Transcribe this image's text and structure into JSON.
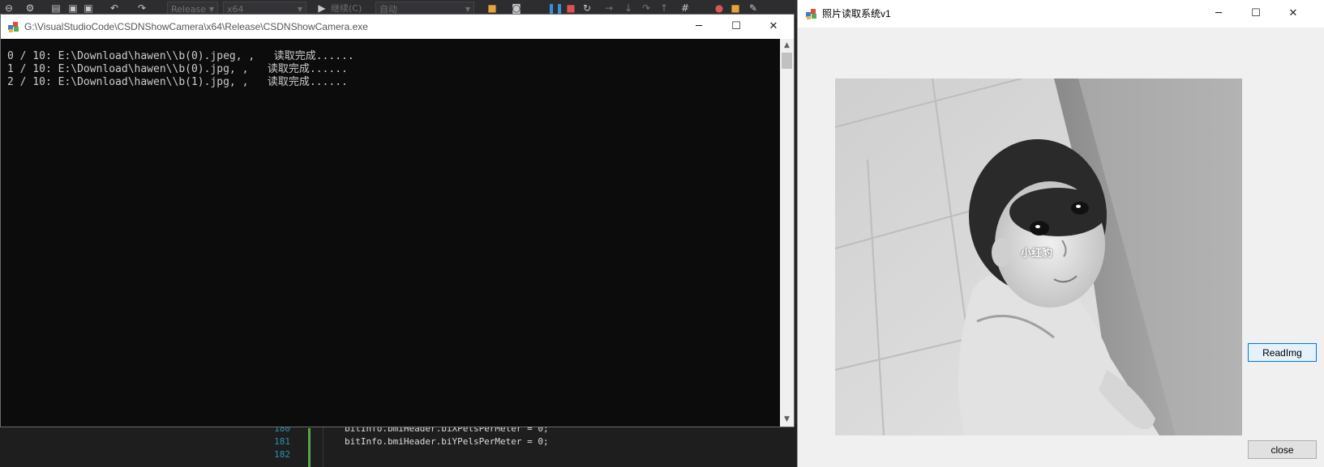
{
  "vs_toolbar": {
    "config_combo": "Release",
    "platform_combo": "x64",
    "continue_label": "继续(C)",
    "auto_combo": "自动"
  },
  "code_editor": {
    "lines": [
      {
        "number": "180",
        "code": "bitInfo.bmiHeader.biXPelsPerMeter = 0;"
      },
      {
        "number": "181",
        "code": "bitInfo.bmiHeader.biYPelsPerMeter = 0;"
      },
      {
        "number": "182",
        "code": ""
      }
    ]
  },
  "console_window": {
    "title": "G:\\VisualStudioCode\\CSDNShowCamera\\x64\\Release\\CSDNShowCamera.exe",
    "lines": [
      "0 / 10: E:\\Download\\hawen\\\\b(0).jpeg, ,   读取完成......",
      "1 / 10: E:\\Download\\hawen\\\\b(0).jpg, ,   读取完成......",
      "2 / 10: E:\\Download\\hawen\\\\b(1).jpg, ,   读取完成......"
    ]
  },
  "photo_window": {
    "title": "照片读取系统v1",
    "image_caption": "小红豹",
    "readimg_button": "ReadImg",
    "close_button": "close"
  },
  "colors": {
    "console_bg": "#0c0c0c",
    "console_text": "#cccccc",
    "button_focus_border": "#0078d7",
    "vs_line_number": "#2b91af"
  },
  "icons": [
    "app-icon",
    "minimize-icon",
    "maximize-icon",
    "close-icon",
    "scroll-up-icon",
    "scroll-down-icon"
  ]
}
